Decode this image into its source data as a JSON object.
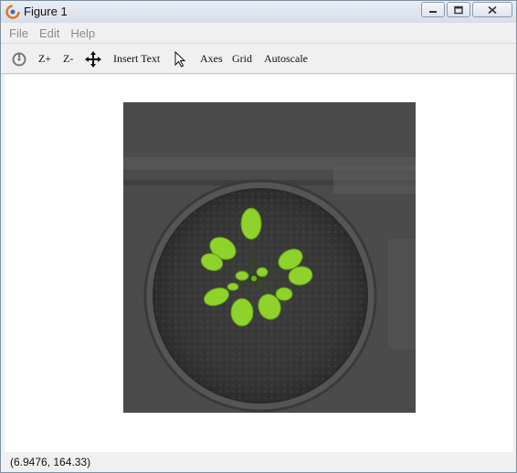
{
  "window": {
    "title": "Figure 1"
  },
  "menu": {
    "items": [
      "File",
      "Edit",
      "Help"
    ]
  },
  "toolbar": {
    "zoom_in_label": "Z+",
    "zoom_out_label": "Z-",
    "insert_text_label": "Insert Text",
    "axes_label": "Axes",
    "grid_label": "Grid",
    "autoscale_label": "Autoscale",
    "icons": [
      "rotate-icon",
      "pan-icon",
      "pointer-icon"
    ]
  },
  "figure": {
    "image_description_icon": "plant-image",
    "background_color": "#4a4a4a",
    "leaf_color": "#8dd22a"
  },
  "status": {
    "coordinates": "(6.9476, 164.33)"
  }
}
